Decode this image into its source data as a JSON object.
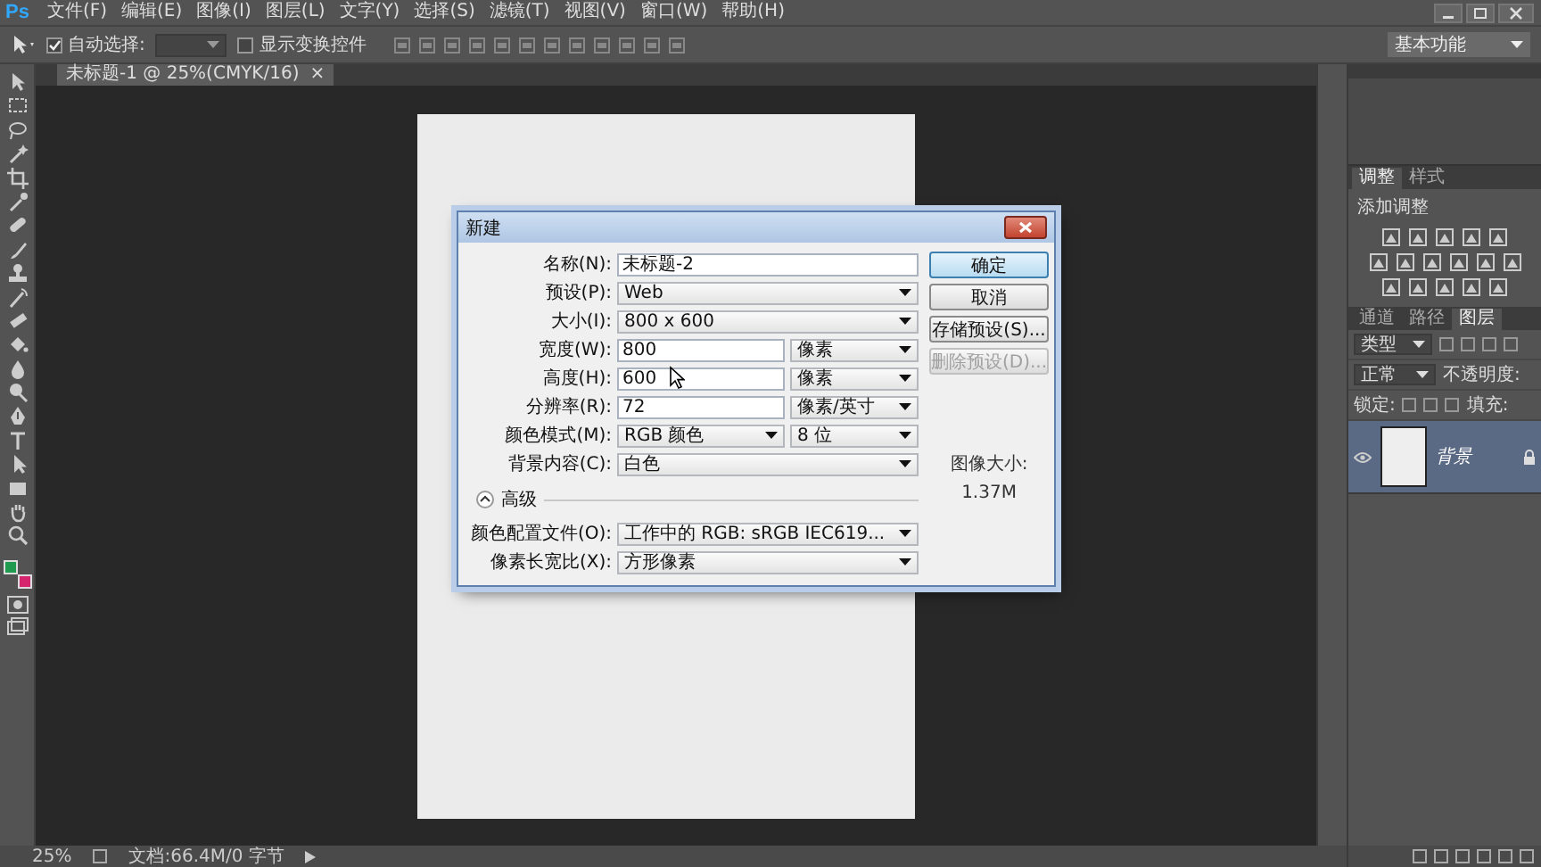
{
  "app": {
    "logo": "Ps"
  },
  "menu": [
    {
      "label": "文件(F)"
    },
    {
      "label": "编辑(E)"
    },
    {
      "label": "图像(I)"
    },
    {
      "label": "图层(L)"
    },
    {
      "label": "文字(Y)"
    },
    {
      "label": "选择(S)"
    },
    {
      "label": "滤镜(T)"
    },
    {
      "label": "视图(V)"
    },
    {
      "label": "窗口(W)"
    },
    {
      "label": "帮助(H)"
    }
  ],
  "options_bar": {
    "auto_select": {
      "label": "自动选择:",
      "checked": true
    },
    "show_transform": {
      "label": "显示变换控件",
      "checked": false
    },
    "workspace": "基本功能"
  },
  "document_tab": {
    "title": "未标题-1 @ 25%(CMYK/16)",
    "close": "×"
  },
  "dialog": {
    "title": "新建",
    "fields": [
      {
        "kind": "text",
        "label": "名称(N):",
        "value": "未标题-2"
      },
      {
        "kind": "select",
        "label": "预设(P):",
        "value": "Web"
      },
      {
        "kind": "select",
        "label": "大小(I):",
        "value": "800 x 600"
      },
      {
        "kind": "text",
        "label": "宽度(W):",
        "value": "800",
        "unit": "像素"
      },
      {
        "kind": "text",
        "label": "高度(H):",
        "value": "600",
        "unit": "像素"
      },
      {
        "kind": "text",
        "label": "分辨率(R):",
        "value": "72",
        "unit": "像素/英寸"
      },
      {
        "kind": "select",
        "label": "颜色模式(M):",
        "value": "RGB 颜色",
        "unit": "8 位"
      },
      {
        "kind": "select",
        "label": "背景内容(C):",
        "value": "白色"
      }
    ],
    "advanced": {
      "label": "高级",
      "expanded": true
    },
    "advanced_fields": [
      {
        "kind": "select",
        "label": "颜色配置文件(O):",
        "value": "工作中的 RGB: sRGB IEC619..."
      },
      {
        "kind": "select",
        "label": "像素长宽比(X):",
        "value": "方形像素"
      }
    ],
    "buttons": [
      {
        "label": "确定",
        "default": true,
        "disabled": false
      },
      {
        "label": "取消",
        "default": false,
        "disabled": false
      },
      {
        "label": "存储预设(S)...",
        "default": false,
        "disabled": false
      },
      {
        "label": "删除预设(D)...",
        "default": false,
        "disabled": true
      }
    ],
    "image_size": {
      "label": "图像大小:",
      "value": "1.37M"
    }
  },
  "panels": {
    "adjust_tabs": [
      {
        "label": "调整",
        "selected": true
      },
      {
        "label": "样式",
        "selected": false
      }
    ],
    "adjust_hint": "添加调整",
    "layer_tabs": [
      {
        "label": "通道",
        "selected": false
      },
      {
        "label": "路径",
        "selected": false
      },
      {
        "label": "图层",
        "selected": true
      }
    ],
    "filter_label": "类型",
    "blend_mode": "正常",
    "opacity_label": "不透明度:",
    "lock_label": "锁定:",
    "fill_label": "填充:",
    "layers": [
      {
        "name": "背景",
        "visible": true,
        "locked": true,
        "selected": true
      }
    ]
  },
  "swatches": [
    {
      "color": "#1f9a4e"
    },
    {
      "color": "#d7246f"
    }
  ],
  "status_bar": {
    "zoom": "25%",
    "doc_info": "文档:66.4M/0 字节"
  }
}
